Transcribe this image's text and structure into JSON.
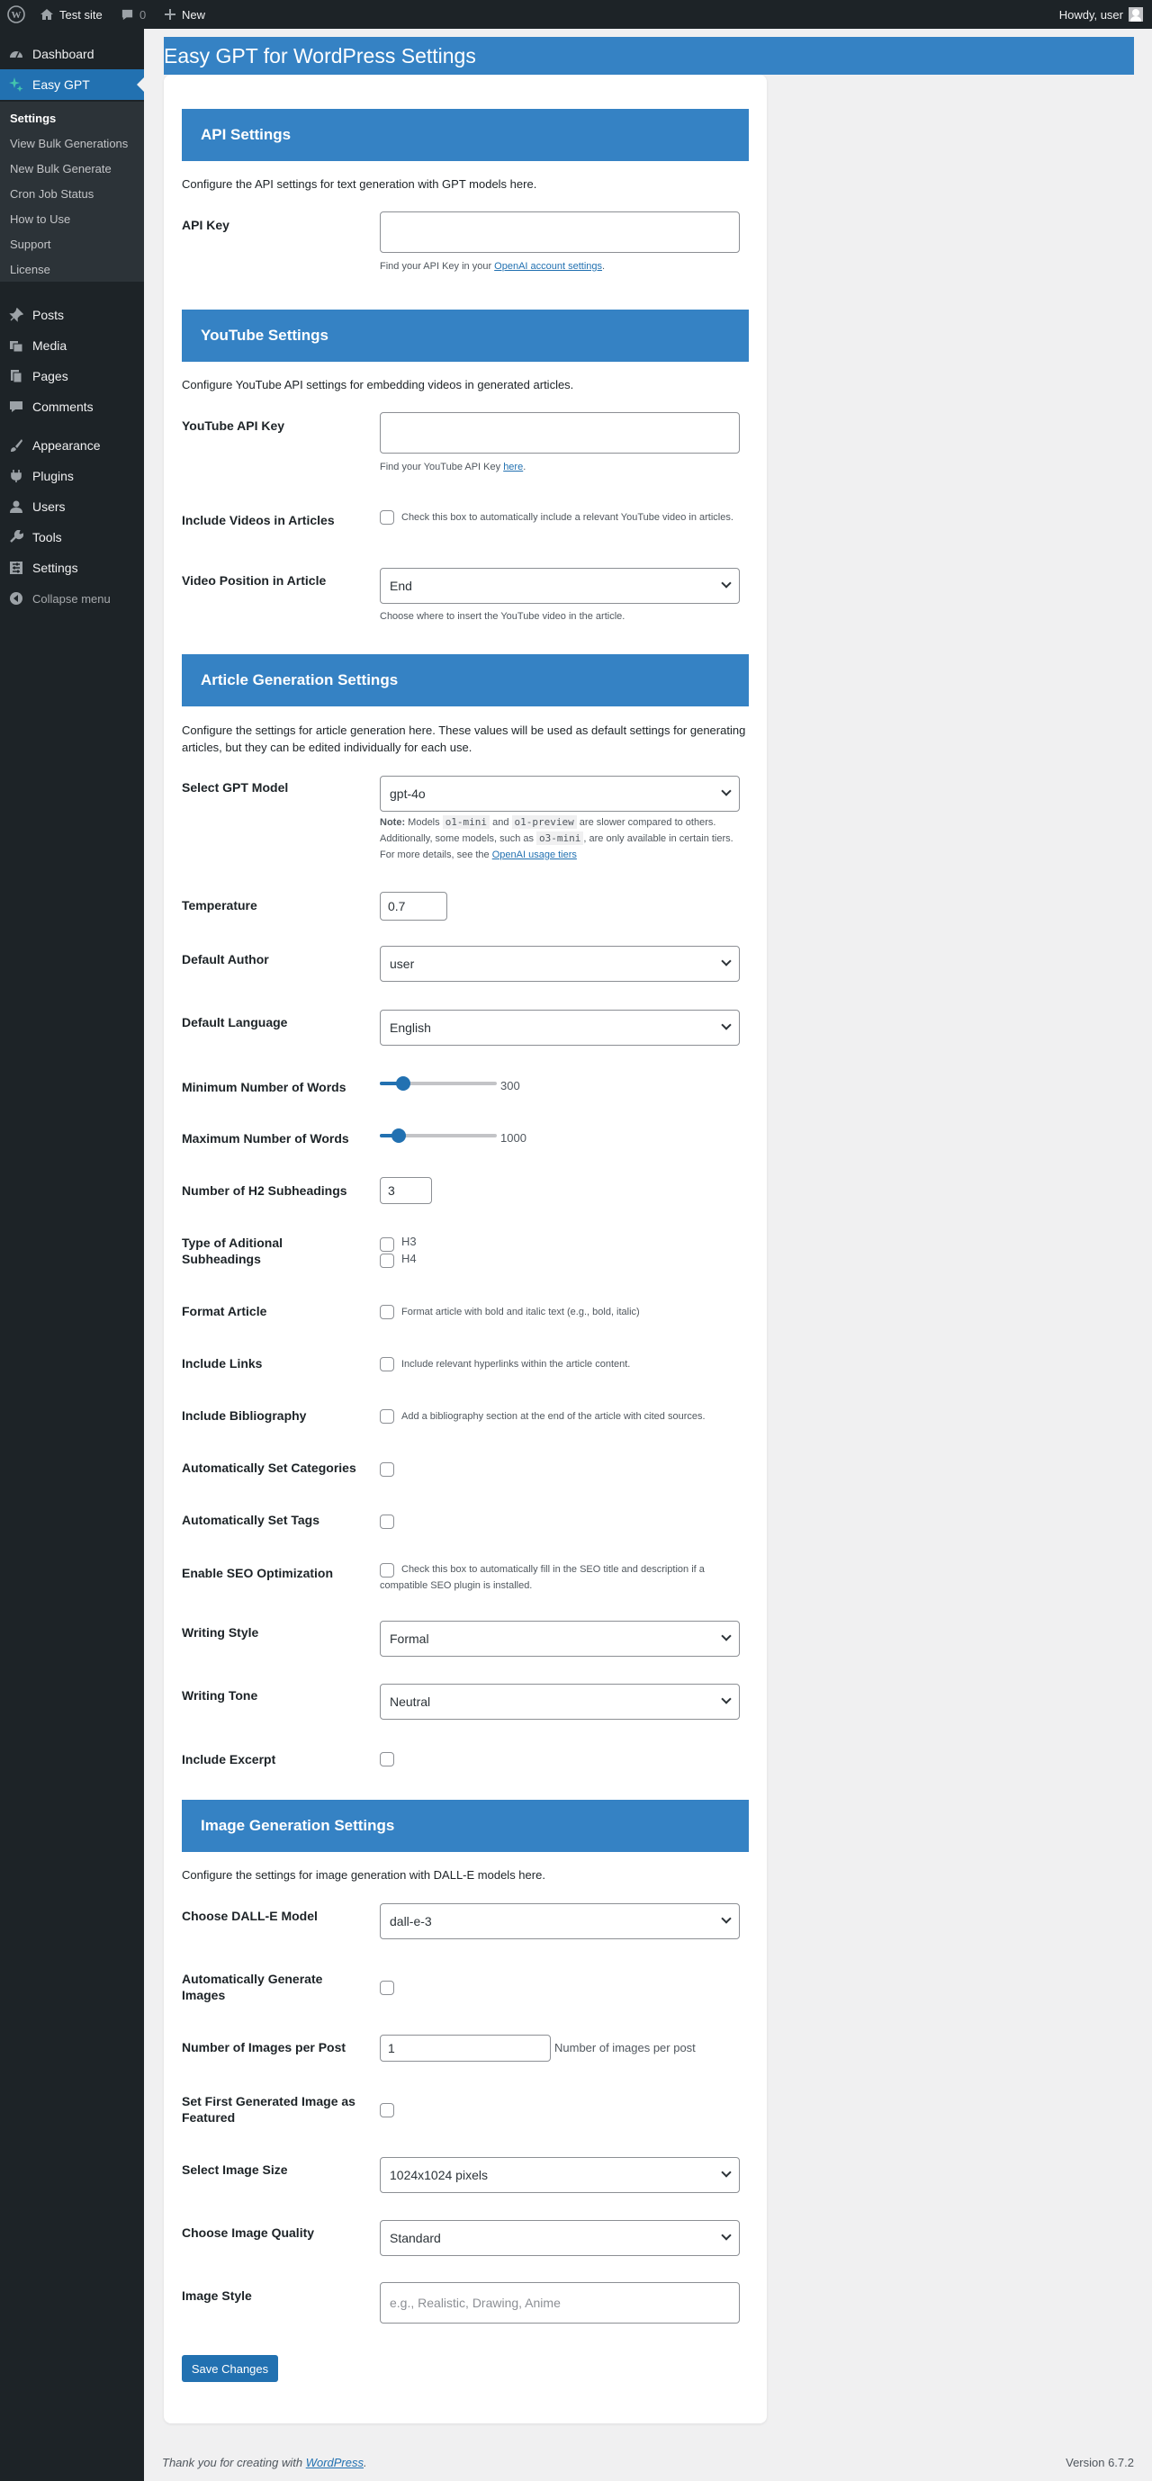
{
  "admin_bar": {
    "site": "Test site",
    "comments": "0",
    "new": "New",
    "howdy": "Howdy, user"
  },
  "menu": {
    "dashboard": "Dashboard",
    "easy_gpt": "Easy GPT",
    "submenu": [
      "Settings",
      "View Bulk Generations",
      "New Bulk Generate",
      "Cron Job Status",
      "How to Use",
      "Support",
      "License"
    ],
    "posts": "Posts",
    "media": "Media",
    "pages": "Pages",
    "comments": "Comments",
    "appearance": "Appearance",
    "plugins": "Plugins",
    "users": "Users",
    "tools": "Tools",
    "settings": "Settings",
    "collapse": "Collapse menu"
  },
  "page_title": "Easy GPT for WordPress Settings",
  "api": {
    "heading": "API Settings",
    "desc": "Configure the API settings for text generation with GPT models here.",
    "key_label": "API Key",
    "key_value": "",
    "key_help_prefix": "Find your API Key in your ",
    "key_help_link": "OpenAI account settings",
    "key_help_suffix": "."
  },
  "youtube": {
    "heading": "YouTube Settings",
    "desc": "Configure YouTube API settings for embedding videos in generated articles.",
    "key_label": "YouTube API Key",
    "key_value": "",
    "key_help_prefix": "Find your YouTube API Key ",
    "key_help_link": "here",
    "key_help_suffix": ".",
    "include_label": "Include Videos in Articles",
    "include_text": "Check this box to automatically include a relevant YouTube video in articles.",
    "position_label": "Video Position in Article",
    "position_value": "End",
    "position_help": "Choose where to insert the YouTube video in the article."
  },
  "article": {
    "heading": "Article Generation Settings",
    "desc": "Configure the settings for article generation here. These values will be used as default settings for generating articles, but they can be edited individually for each use.",
    "model_label": "Select GPT Model",
    "model_value": "gpt-4o",
    "note_bold": "Note:",
    "note_1": " Models ",
    "note_code1": "o1-mini",
    "note_2": " and ",
    "note_code2": "o1-preview",
    "note_3": " are slower compared to others. Additionally, some models, such as ",
    "note_code3": "o3-mini",
    "note_4": ", are only available in certain tiers. For more details, see the ",
    "note_link": "OpenAI usage tiers",
    "temperature_label": "Temperature",
    "temperature_value": "0.7",
    "author_label": "Default Author",
    "author_value": "user",
    "language_label": "Default Language",
    "language_value": "English",
    "min_words_label": "Minimum Number of Words",
    "min_words_value": "300",
    "min_words_level": 0.2,
    "max_words_label": "Maximum Number of Words",
    "max_words_value": "1000",
    "max_words_level": 0.16,
    "h2_label": "Number of H2 Subheadings",
    "h2_value": "3",
    "type_label": "Type of Aditional Subheadings",
    "h3": "H3",
    "h4": "H4",
    "format_label": "Format Article",
    "format_text": "Format article with bold and italic text (e.g., bold, italic)",
    "links_label": "Include Links",
    "links_text": "Include relevant hyperlinks within the article content.",
    "bib_label": "Include Bibliography",
    "bib_text": "Add a bibliography section at the end of the article with cited sources.",
    "cats_label": "Automatically Set Categories",
    "tags_label": "Automatically Set Tags",
    "seo_label": "Enable SEO Optimization",
    "seo_text": "Check this box to automatically fill in the SEO title and description if a compatible SEO plugin is installed.",
    "style_label": "Writing Style",
    "style_value": "Formal",
    "tone_label": "Writing Tone",
    "tone_value": "Neutral",
    "excerpt_label": "Include Excerpt"
  },
  "image": {
    "heading": "Image Generation Settings",
    "desc": "Configure the settings for image generation with DALL-E models here.",
    "model_label": "Choose DALL-E Model",
    "model_value": "dall-e-3",
    "auto_label": "Automatically Generate Images",
    "count_label": "Number of Images per Post",
    "count_value": "1",
    "count_help": "Number of images per post",
    "featured_label": "Set First Generated Image as Featured",
    "size_label": "Select Image Size",
    "size_value": "1024x1024 pixels",
    "quality_label": "Choose Image Quality",
    "quality_value": "Standard",
    "style_label": "Image Style",
    "style_placeholder": "e.g., Realistic, Drawing, Anime"
  },
  "save_label": "Save Changes",
  "footer": {
    "prefix": "Thank you for creating with ",
    "link": "WordPress",
    "suffix": "."
  },
  "version": "Version 6.7.2"
}
